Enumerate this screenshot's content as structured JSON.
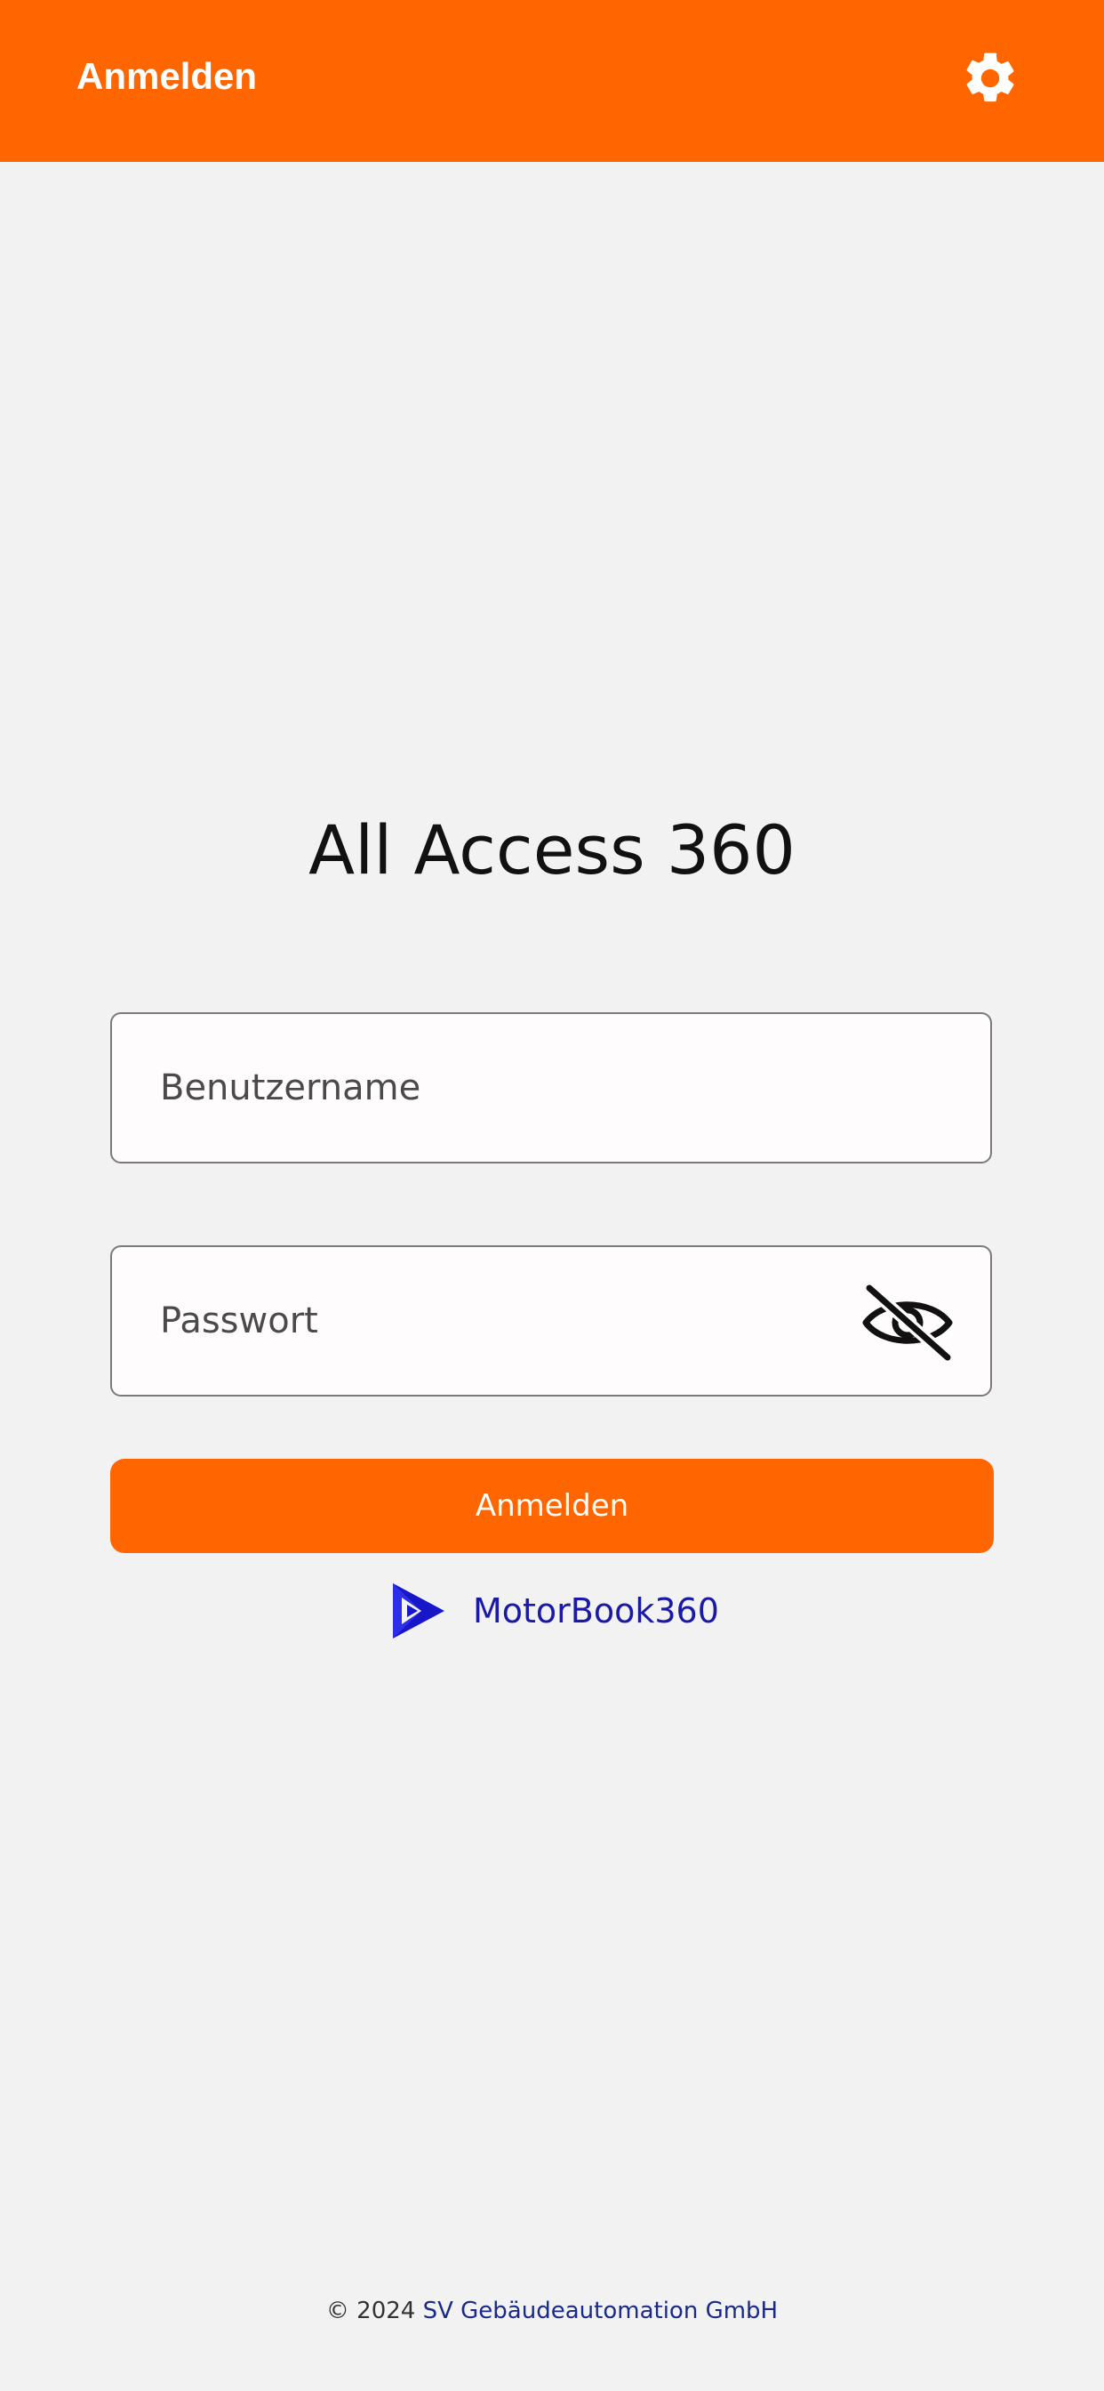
{
  "app_bar": {
    "title": "Anmelden",
    "settings_icon": "gear-icon",
    "background_color": "#ff6600"
  },
  "login": {
    "app_title": "All Access 360",
    "username_placeholder": "Benutzername",
    "password_placeholder": "Passwort",
    "password_visibility_icon": "eye-off-icon",
    "submit_label": "Anmelden",
    "accent_color": "#ff6600"
  },
  "link": {
    "label": "MotorBook360",
    "icon": "play-store-icon",
    "color": "#1a1aa6"
  },
  "footer": {
    "copyright": "© 2024",
    "company": "SV Gebäudeautomation GmbH"
  }
}
